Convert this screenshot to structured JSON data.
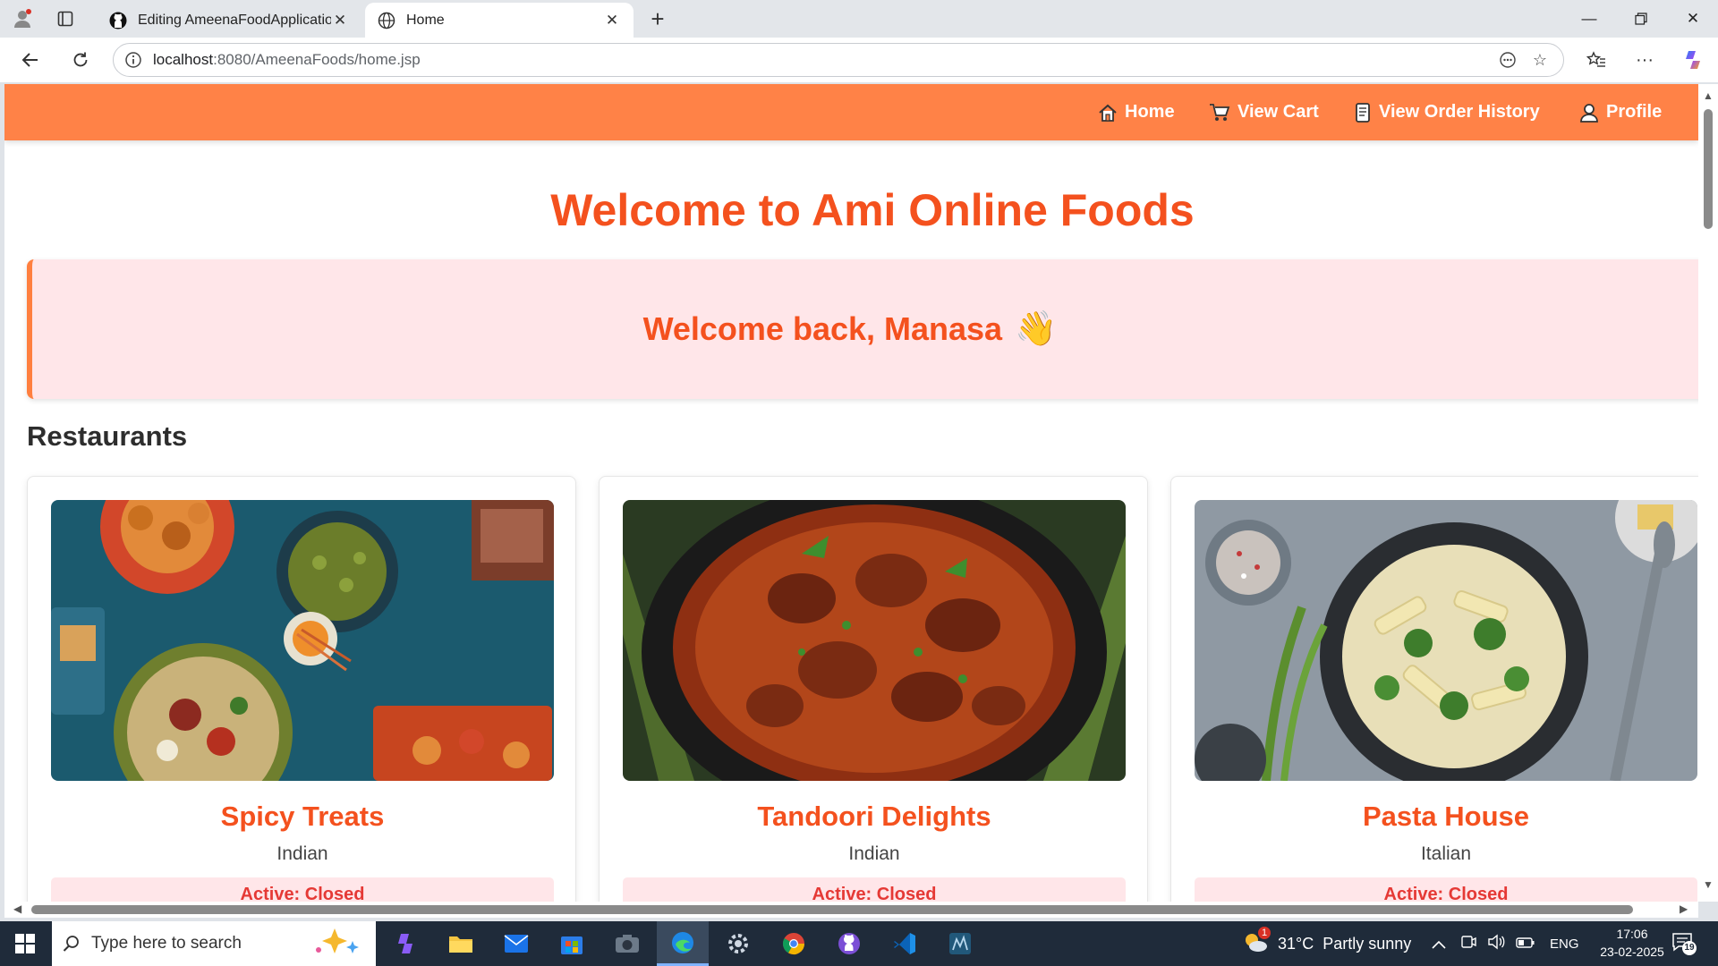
{
  "browser": {
    "tabs": [
      {
        "label": "Editing AmeenaFoodApplication/",
        "icon": "github-icon",
        "active": false
      },
      {
        "label": "Home",
        "icon": "globe-icon",
        "active": true
      }
    ],
    "url_host": "localhost",
    "url_path": ":8080/AmeenaFoods/home.jsp"
  },
  "nav": {
    "items": [
      {
        "label": "Home",
        "icon": "home-icon"
      },
      {
        "label": "View Cart",
        "icon": "cart-icon"
      },
      {
        "label": "View Order History",
        "icon": "scroll-icon"
      },
      {
        "label": "Profile",
        "icon": "user-icon"
      }
    ]
  },
  "page": {
    "title": "Welcome to Ami Online Foods",
    "welcome": "Welcome back, Manasa",
    "wave": "👋",
    "section_title": "Restaurants"
  },
  "restaurants": [
    {
      "name": "Spicy Treats",
      "cuisine": "Indian",
      "status": "Active: Closed",
      "image": "assorted-dishes-photo"
    },
    {
      "name": "Tandoori Delights",
      "cuisine": "Indian",
      "status": "Active: Closed",
      "image": "curry-pot-photo"
    },
    {
      "name": "Pasta House",
      "cuisine": "Italian",
      "status": "Active: Closed",
      "image": "pasta-bowl-photo"
    }
  ],
  "taskbar": {
    "search_placeholder": "Type here to search",
    "weather": "31°C  Partly sunny",
    "weather_badge": "1",
    "language": "ENG",
    "time": "17:06",
    "date": "23-02-2025",
    "notifications": "19"
  },
  "colors": {
    "nav_bg": "#ff8247",
    "accent": "#f4511e",
    "welcome_bg": "#ffe6e9",
    "status_text": "#e53935"
  }
}
